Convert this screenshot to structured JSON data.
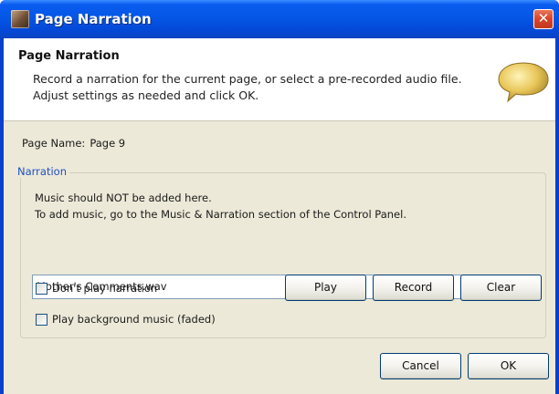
{
  "window": {
    "title": "Page Narration",
    "close_label": "✕"
  },
  "header": {
    "title": "Page Narration",
    "description": "Record a narration for the current page, or select a pre-recorded audio file. Adjust settings as needed and click OK.",
    "icon": "speech-bubble-icon"
  },
  "page_name": {
    "label": "Page Name:",
    "value": "Page 9"
  },
  "narration": {
    "legend": "Narration",
    "notice_line1": "Music should NOT be added here.",
    "notice_line2": "To add music, go to the Music & Narration section of the Control Panel.",
    "file_value": "Mother's Comments.wav",
    "browse_icon": "open-folder-icon",
    "dont_play_label": "Don't play narration",
    "dont_play_checked": false,
    "background_music_label": "Play background music (faded)",
    "background_music_checked": false,
    "play_label": "Play",
    "record_label": "Record",
    "clear_label": "Clear"
  },
  "footer": {
    "cancel_label": "Cancel",
    "ok_label": "OK"
  },
  "colors": {
    "titlebar": "#0557e6",
    "dialog_face": "#ece9d8",
    "legend_text": "#1f4fc2",
    "close_button": "#d8432a"
  }
}
